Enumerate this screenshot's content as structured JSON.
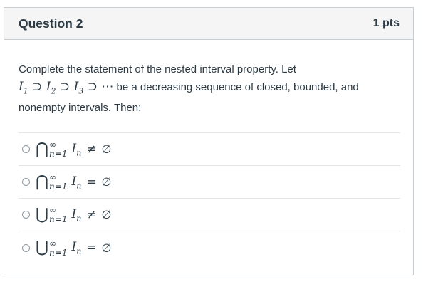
{
  "question": {
    "title": "Question 2",
    "points": "1 pts",
    "prompt_part1": "Complete the statement of the nested interval property.  Let",
    "prompt_part2": "be a decreasing sequence of closed, bounded, and nonempty intervals.  Then:",
    "sequence": {
      "i1": "I",
      "s1": "1",
      "i2": "I",
      "s2": "2",
      "i3": "I",
      "s3": "3",
      "supset": "⊃",
      "dots": "⋯"
    }
  },
  "answers": [
    {
      "op": "⋂",
      "upper": "∞",
      "lower": "n=1",
      "term": "I",
      "sub": "n",
      "rel": "≠",
      "rhs": "∅"
    },
    {
      "op": "⋂",
      "upper": "∞",
      "lower": "n=1",
      "term": "I",
      "sub": "n",
      "rel": "=",
      "rhs": "∅"
    },
    {
      "op": "⋃",
      "upper": "∞",
      "lower": "n=1",
      "term": "I",
      "sub": "n",
      "rel": "≠",
      "rhs": "∅"
    },
    {
      "op": "⋃",
      "upper": "∞",
      "lower": "n=1",
      "term": "I",
      "sub": "n",
      "rel": "=",
      "rhs": "∅"
    }
  ]
}
